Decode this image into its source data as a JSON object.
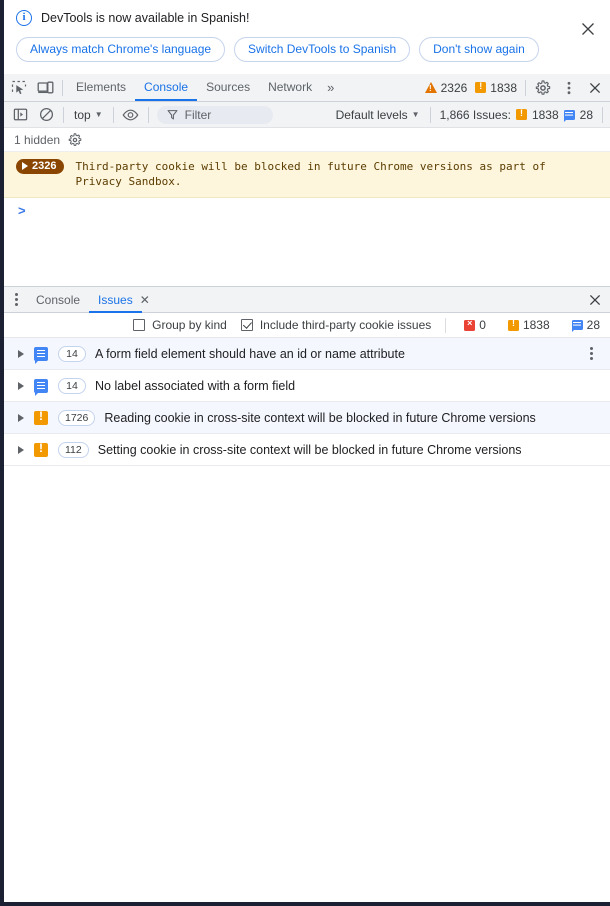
{
  "banner": {
    "icon": "info-circle-icon",
    "message": "DevTools is now available in Spanish!",
    "buttons": [
      {
        "label": "Always match Chrome's language"
      },
      {
        "label": "Switch DevTools to Spanish"
      },
      {
        "label": "Don't show again"
      }
    ],
    "close_icon": "close-icon"
  },
  "toolbar": {
    "inspect_icon": "inspect-element-icon",
    "device_icon": "device-toolbar-icon",
    "tabs": [
      {
        "label": "Elements",
        "active": false
      },
      {
        "label": "Console",
        "active": true
      },
      {
        "label": "Sources",
        "active": false
      },
      {
        "label": "Network",
        "active": false
      }
    ],
    "more_tabs_icon": "chevron-double-right-icon",
    "warning_count": "2326",
    "issue_count": "1838",
    "settings_icon": "gear-icon",
    "menu_icon": "kebab-menu-icon",
    "close_icon": "close-icon"
  },
  "console_toolbar": {
    "sidebar_icon": "console-sidebar-icon",
    "clear_icon": "clear-console-icon",
    "context_label": "top",
    "eye_icon": "live-expression-eye-icon",
    "filter_icon": "filter-funnel-icon",
    "filter_placeholder": "Filter",
    "filter_value": "",
    "levels_label": "Default levels",
    "issues_label": "1,866 Issues:",
    "issues_warning_count": "1838",
    "issues_info_count": "28"
  },
  "console": {
    "hidden_label": "1 hidden",
    "hidden_settings_icon": "gear-icon",
    "messages": [
      {
        "count": "2326",
        "text": "Third-party cookie will be blocked in future Chrome versions as part of\nPrivacy Sandbox.",
        "level": "warning"
      }
    ],
    "prompt_caret": ">"
  },
  "drawer": {
    "menu_icon": "kebab-menu-icon",
    "tabs": [
      {
        "label": "Console",
        "active": false,
        "closable": false
      },
      {
        "label": "Issues",
        "active": true,
        "closable": true
      }
    ],
    "tab_close_icon": "close-icon",
    "close_icon": "close-icon",
    "toolbar": {
      "group_by_kind_label": "Group by kind",
      "group_by_kind_checked": false,
      "include_third_party_label": "Include third-party cookie issues",
      "include_third_party_checked": true,
      "error_count": "0",
      "warning_count": "1838",
      "info_count": "28"
    },
    "issues": [
      {
        "kind": "info",
        "icon": "page-issue-icon",
        "count": "14",
        "title": "A form field element should have an id or name attribute",
        "has_menu": true
      },
      {
        "kind": "info",
        "icon": "page-issue-icon",
        "count": "14",
        "title": "No label associated with a form field",
        "has_menu": false
      },
      {
        "kind": "warning",
        "icon": "warning-issue-icon",
        "count": "1726",
        "title": "Reading cookie in cross-site context will be blocked in future Chrome versions",
        "has_menu": false
      },
      {
        "kind": "warning",
        "icon": "warning-issue-icon",
        "count": "112",
        "title": "Setting cookie in cross-site context will be blocked in future Chrome versions",
        "has_menu": false
      }
    ]
  },
  "colors": {
    "accent": "#1a73e8",
    "warning": "#f29900",
    "error": "#ea4335",
    "info": "#4285f4",
    "console_warning_bg": "#fdf6dd"
  }
}
